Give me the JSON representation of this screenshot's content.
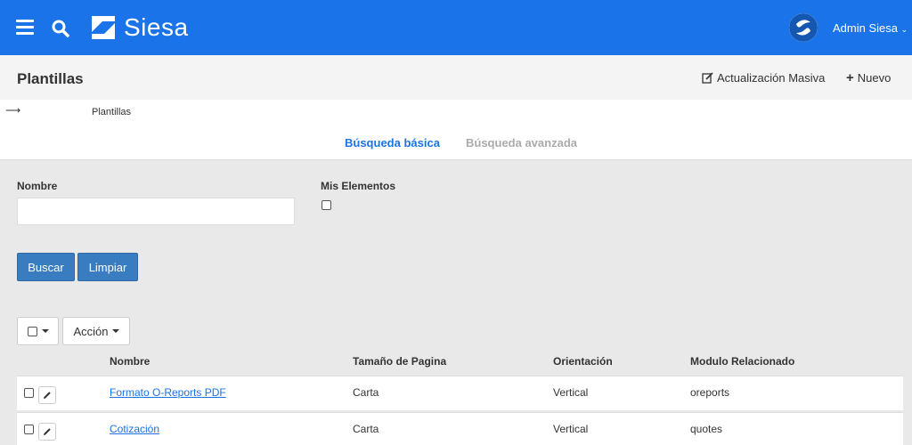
{
  "header": {
    "logo_text": "Siesa",
    "user_name": "Admin Siesa",
    "brand_color": "#1a73e8"
  },
  "titlebar": {
    "title": "Plantillas",
    "bulk_update_label": "Actualización Masiva",
    "new_label": "Nuevo"
  },
  "breadcrumb": {
    "current": "Plantillas"
  },
  "tabs": {
    "basic": "Búsqueda básica",
    "advanced": "Búsqueda avanzada"
  },
  "search": {
    "name_label": "Nombre",
    "name_value": "",
    "my_items_label": "Mis Elementos",
    "search_button": "Buscar",
    "clear_button": "Limpiar"
  },
  "list": {
    "action_label": "Acción",
    "columns": {
      "name": "Nombre",
      "page_size": "Tamaño de Pagina",
      "orientation": "Orientación",
      "module": "Modulo Relacionado"
    },
    "rows": [
      {
        "name": "Formato O-Reports PDF",
        "page_size": "Carta",
        "orientation": "Vertical",
        "module": "oreports"
      },
      {
        "name": "Cotización",
        "page_size": "Carta",
        "orientation": "Vertical",
        "module": "quotes"
      }
    ]
  }
}
